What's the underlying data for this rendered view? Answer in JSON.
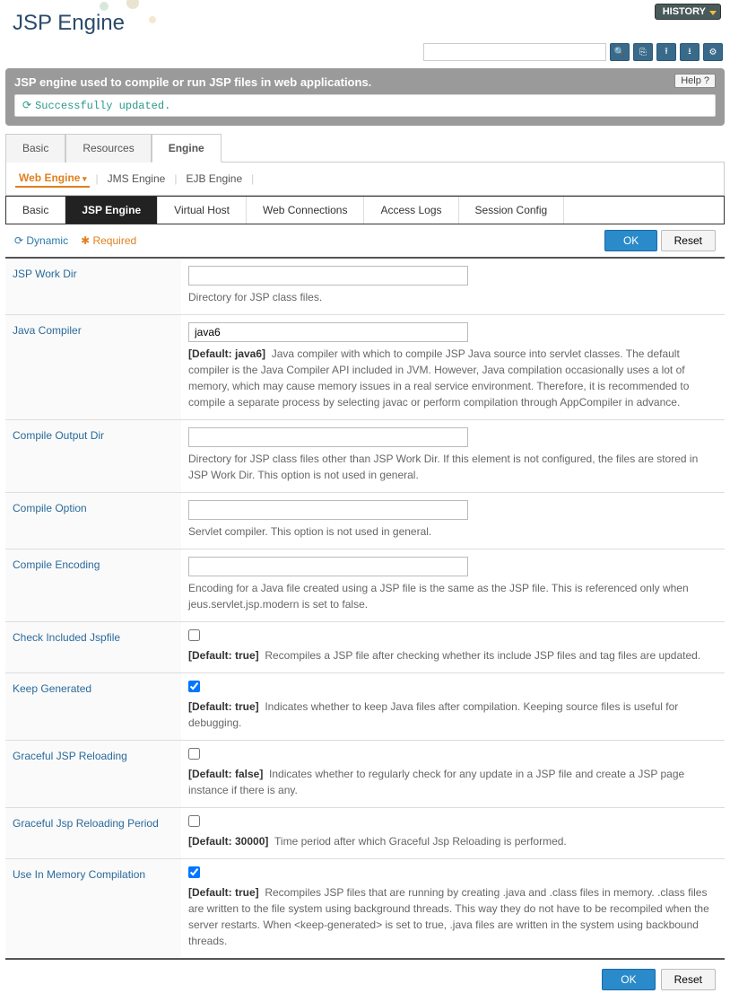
{
  "page_title": "JSP Engine",
  "history_label": "HISTORY",
  "banner": {
    "text": "JSP engine used to compile or run JSP files in web applications.",
    "help_label": "Help ?",
    "status": "Successfully updated."
  },
  "tabs_primary": [
    "Basic",
    "Resources",
    "Engine"
  ],
  "tabs_primary_active": 2,
  "subtabs": [
    "Web Engine",
    "JMS Engine",
    "EJB Engine"
  ],
  "subtabs_active": 0,
  "tabs_tertiary": [
    "Basic",
    "JSP Engine",
    "Virtual Host",
    "Web Connections",
    "Access Logs",
    "Session Config"
  ],
  "tabs_tertiary_active": 1,
  "legend": {
    "dynamic": "Dynamic",
    "required": "Required"
  },
  "buttons": {
    "ok": "OK",
    "reset": "Reset"
  },
  "fields": {
    "jsp_work_dir": {
      "label": "JSP Work Dir",
      "value": "",
      "desc": "Directory for JSP class files."
    },
    "java_compiler": {
      "label": "Java Compiler",
      "value": "java6",
      "default": "[Default: java6]",
      "desc": "Java compiler with which to compile JSP Java source into servlet classes. The default compiler is the Java Compiler API included in JVM. However, Java compilation occasionally uses a lot of memory, which may cause memory issues in a real service environment. Therefore, it is recommended to compile a separate process by selecting javac or perform compilation through AppCompiler in advance."
    },
    "compile_output_dir": {
      "label": "Compile Output Dir",
      "value": "",
      "desc": "Directory for JSP class files other than JSP Work Dir. If this element is not configured, the files are stored in JSP Work Dir. This option is not used in general."
    },
    "compile_option": {
      "label": "Compile Option",
      "value": "",
      "desc": "Servlet compiler. This option is not used in general."
    },
    "compile_encoding": {
      "label": "Compile Encoding",
      "value": "",
      "desc": "Encoding for a Java file created using a JSP file is the same as the JSP file. This is referenced only when jeus.servlet.jsp.modern is set to false."
    },
    "check_included_jspfile": {
      "label": "Check Included Jspfile",
      "checked": false,
      "default": "[Default: true]",
      "desc": "Recompiles a JSP file after checking whether its include JSP files and tag files are updated."
    },
    "keep_generated": {
      "label": "Keep Generated",
      "checked": true,
      "default": "[Default: true]",
      "desc": "Indicates whether to keep Java files after compilation. Keeping source files is useful for debugging."
    },
    "graceful_jsp_reloading": {
      "label": "Graceful JSP Reloading",
      "checked": false,
      "default": "[Default: false]",
      "desc": "Indicates whether to regularly check for any update in a JSP file and create a JSP page instance if there is any."
    },
    "graceful_jsp_reloading_period": {
      "label": "Graceful Jsp Reloading Period",
      "checked": false,
      "default": "[Default: 30000]",
      "desc": "Time period after which Graceful Jsp Reloading is performed."
    },
    "use_in_memory_compilation": {
      "label": "Use In Memory Compilation",
      "checked": true,
      "default": "[Default: true]",
      "desc": "Recompiles JSP files that are running by creating .java and .class files in memory. .class files are written to the file system using background threads. This way they do not have to be recompiled when the server restarts. When <keep-generated> is set to true, .java files are written in the system using backbound threads."
    }
  }
}
